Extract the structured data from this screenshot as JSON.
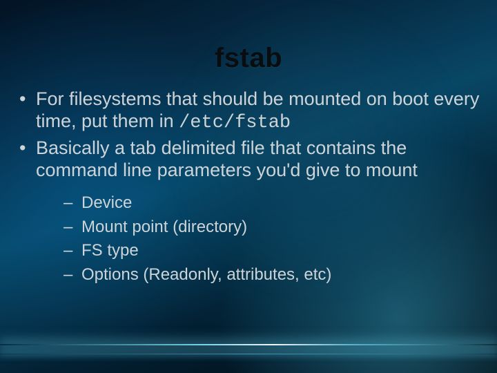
{
  "title": "fstab",
  "bullets": [
    {
      "pre": "For filesystems that should be mounted on boot every time, put them in ",
      "code": "/etc/fstab",
      "post": ""
    },
    {
      "text": "Basically a tab delimited file that contains the command line parameters you'd give to mount"
    }
  ],
  "subitems": [
    "Device",
    "Mount point (directory)",
    "FS type",
    "Options (Readonly, attributes, etc)"
  ]
}
